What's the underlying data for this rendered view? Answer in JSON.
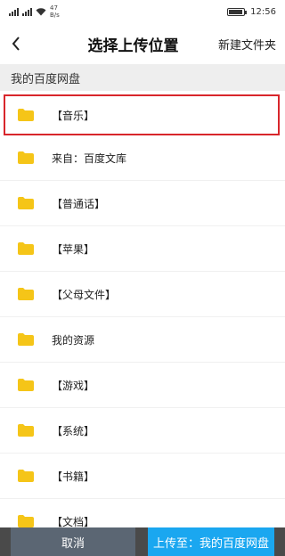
{
  "status_bar": {
    "net_value": "47",
    "net_unit": "B/s",
    "battery": "",
    "time": "12:56"
  },
  "header": {
    "back_icon": "chevron-left-icon",
    "title": "选择上传位置",
    "new_folder": "新建文件夹"
  },
  "section": {
    "title": "我的百度网盘"
  },
  "folders": [
    {
      "label": "【音乐】"
    },
    {
      "label": "来自：百度文库"
    },
    {
      "label": "【普通话】"
    },
    {
      "label": "【苹果】"
    },
    {
      "label": "【父母文件】"
    },
    {
      "label": "我的资源"
    },
    {
      "label": "【游戏】"
    },
    {
      "label": "【系统】"
    },
    {
      "label": "【书籍】"
    },
    {
      "label": "【文档】"
    }
  ],
  "bottom": {
    "cancel": "取消",
    "upload": "上传至：我的百度网盘"
  },
  "colors": {
    "highlight": "#d8262b",
    "folder": "#f5c518",
    "upload_button": "#1aa7f0",
    "cancel_button": "#5b6673"
  }
}
